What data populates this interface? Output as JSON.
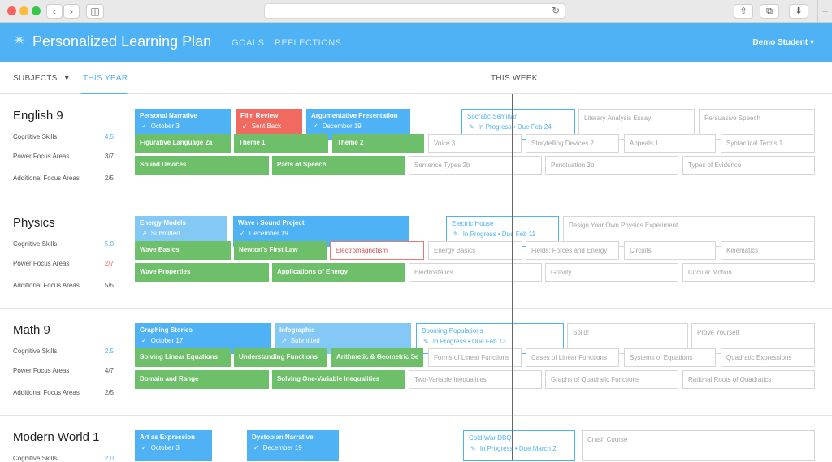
{
  "browser": {
    "back_icon": "chevron-left-icon",
    "forward_icon": "chevron-right-icon",
    "sidebar_icon": "sidebar-icon",
    "reload_icon": "reload-icon",
    "share_icon": "share-icon",
    "tabs_icon": "tabs-icon",
    "download_icon": "download-icon",
    "new_tab_icon": "plus-icon"
  },
  "header": {
    "logo_icon": "star-logo-icon",
    "title": "Personalized Learning Plan",
    "nav": [
      "GOALS",
      "REFLECTIONS"
    ],
    "user": "Demo Student",
    "accent": "#4eb2f4"
  },
  "subheader": {
    "subjects": "SUBJECTS",
    "this_year": "THIS YEAR",
    "this_week": "THIS WEEK"
  },
  "subjects": [
    {
      "name": "English 9",
      "rows": [
        {
          "label": "Cognitive Skills",
          "value": "4.5",
          "tone": "blue"
        },
        {
          "label": "Power Focus Areas",
          "value": "3/7",
          "tone": "normal"
        },
        {
          "label": "Additional Focus Areas",
          "value": "2/5",
          "tone": "normal"
        }
      ],
      "cards": [
        [
          {
            "title": "Personal Narrative",
            "status": "October 3",
            "kind": "blue",
            "icon": "check-icon"
          },
          {
            "title": "Film Review",
            "status": "Sent Back",
            "kind": "red",
            "icon": "arrow-down-left-icon"
          },
          {
            "title": "Argumentative Presentation",
            "status": "December 19",
            "kind": "blue",
            "icon": "check-icon"
          },
          {
            "title": "Socratic Seminar",
            "status": "In Progress • Due Feb 24",
            "kind": "current",
            "icon": "pencil-icon"
          },
          {
            "title": "Literary Analysis Essay",
            "kind": "outline"
          },
          {
            "title": "Persuasive Speech",
            "kind": "outline"
          }
        ],
        [
          {
            "title": "Figurative Language 2a",
            "kind": "green"
          },
          {
            "title": "Theme 1",
            "kind": "green"
          },
          {
            "title": "Theme 2",
            "kind": "green"
          },
          {
            "title": "Voice 3",
            "kind": "outline"
          },
          {
            "title": "Storytelling Devices 2",
            "kind": "outline"
          },
          {
            "title": "Appeals 1",
            "kind": "outline"
          },
          {
            "title": "Syntactical Terms 1",
            "kind": "outline"
          }
        ],
        [
          {
            "title": "Sound Devices",
            "kind": "green"
          },
          {
            "title": "Parts of Speech",
            "kind": "green"
          },
          {
            "title": "Sentence Types 2b",
            "kind": "outline"
          },
          {
            "title": "Punctuation 3b",
            "kind": "outline"
          },
          {
            "title": "Types of Evidence",
            "kind": "outline"
          }
        ]
      ]
    },
    {
      "name": "Physics",
      "rows": [
        {
          "label": "Cognitive Skills",
          "value": "5.0",
          "tone": "blue"
        },
        {
          "label": "Power Focus Areas",
          "value": "2/7",
          "tone": "red"
        },
        {
          "label": "Additional Focus Areas",
          "value": "5/5",
          "tone": "normal"
        }
      ],
      "cards": [
        [
          {
            "title": "Energy Models",
            "status": "Submitted",
            "kind": "lblue",
            "icon": "arrow-up-right-icon"
          },
          {
            "title": "Wave / Sound Project",
            "status": "December 19",
            "kind": "blue",
            "icon": "check-icon"
          },
          {
            "title": "Electric House",
            "status": "In Progress • Due Feb 11",
            "kind": "current",
            "icon": "pencil-icon"
          },
          {
            "title": "Design Your Own Physics Experiment",
            "kind": "outline"
          }
        ],
        [
          {
            "title": "Wave Basics",
            "kind": "green"
          },
          {
            "title": "Newton's First Law",
            "kind": "green"
          },
          {
            "title": "Electromagnetism",
            "kind": "outline-red"
          },
          {
            "title": "Energy Basics",
            "kind": "outline"
          },
          {
            "title": "Fields: Forces and Energy",
            "kind": "outline"
          },
          {
            "title": "Circuits",
            "kind": "outline"
          },
          {
            "title": "Kinematics",
            "kind": "outline"
          }
        ],
        [
          {
            "title": "Wave Properties",
            "kind": "green"
          },
          {
            "title": "Applications of Energy",
            "kind": "green"
          },
          {
            "title": "Electrostatics",
            "kind": "outline"
          },
          {
            "title": "Gravity",
            "kind": "outline"
          },
          {
            "title": "Circular Motion",
            "kind": "outline"
          }
        ]
      ]
    },
    {
      "name": "Math 9",
      "rows": [
        {
          "label": "Cognitive Skills",
          "value": "2.5",
          "tone": "blue"
        },
        {
          "label": "Power Focus Areas",
          "value": "4/7",
          "tone": "normal"
        },
        {
          "label": "Additional Focus Areas",
          "value": "2/5",
          "tone": "normal"
        }
      ],
      "cards": [
        [
          {
            "title": "Graphing Stories",
            "status": "October 17",
            "kind": "blue",
            "icon": "check-icon"
          },
          {
            "title": "Infographic",
            "status": "Submitted",
            "kind": "lblue",
            "icon": "arrow-up-right-icon"
          },
          {
            "title": "Booming Populations",
            "status": "In Progress • Due Feb 13",
            "kind": "current",
            "icon": "pencil-icon"
          },
          {
            "title": "Solid!",
            "kind": "outline"
          },
          {
            "title": "Prove Yourself",
            "kind": "outline"
          }
        ],
        [
          {
            "title": "Solving Linear Equations",
            "kind": "green"
          },
          {
            "title": "Understanding Functions",
            "kind": "green"
          },
          {
            "title": "Arithmetic & Geometric Se",
            "kind": "green"
          },
          {
            "title": "Forms of Linear Functions",
            "kind": "outline"
          },
          {
            "title": "Cases of Linear Functions",
            "kind": "outline"
          },
          {
            "title": "Systems of Equations",
            "kind": "outline"
          },
          {
            "title": "Quadratic Expressions",
            "kind": "outline"
          }
        ],
        [
          {
            "title": "Domain and Range",
            "kind": "green"
          },
          {
            "title": "Solving One-Variable Inequalities",
            "kind": "green"
          },
          {
            "title": "Two-Variable Inequalities",
            "kind": "outline"
          },
          {
            "title": "Graphs of Quadratic Functions",
            "kind": "outline"
          },
          {
            "title": "Rational Roots of Quadratics",
            "kind": "outline"
          }
        ]
      ]
    },
    {
      "name": "Modern World 1",
      "rows": [
        {
          "label": "Cognitive Skills",
          "value": "2.0",
          "tone": "blue"
        }
      ],
      "cards": [
        [
          {
            "title": "Art as Expression",
            "status": "October 3",
            "kind": "blue",
            "icon": "check-icon"
          },
          {
            "title": "Dystopian Narrative",
            "status": "December 19",
            "kind": "blue",
            "icon": "check-icon"
          },
          {
            "title": "Cold War DBQ",
            "status": "In Progress • Due March 2",
            "kind": "current",
            "icon": "pencil-icon"
          },
          {
            "title": "Crash Course",
            "kind": "outline"
          }
        ]
      ]
    }
  ]
}
